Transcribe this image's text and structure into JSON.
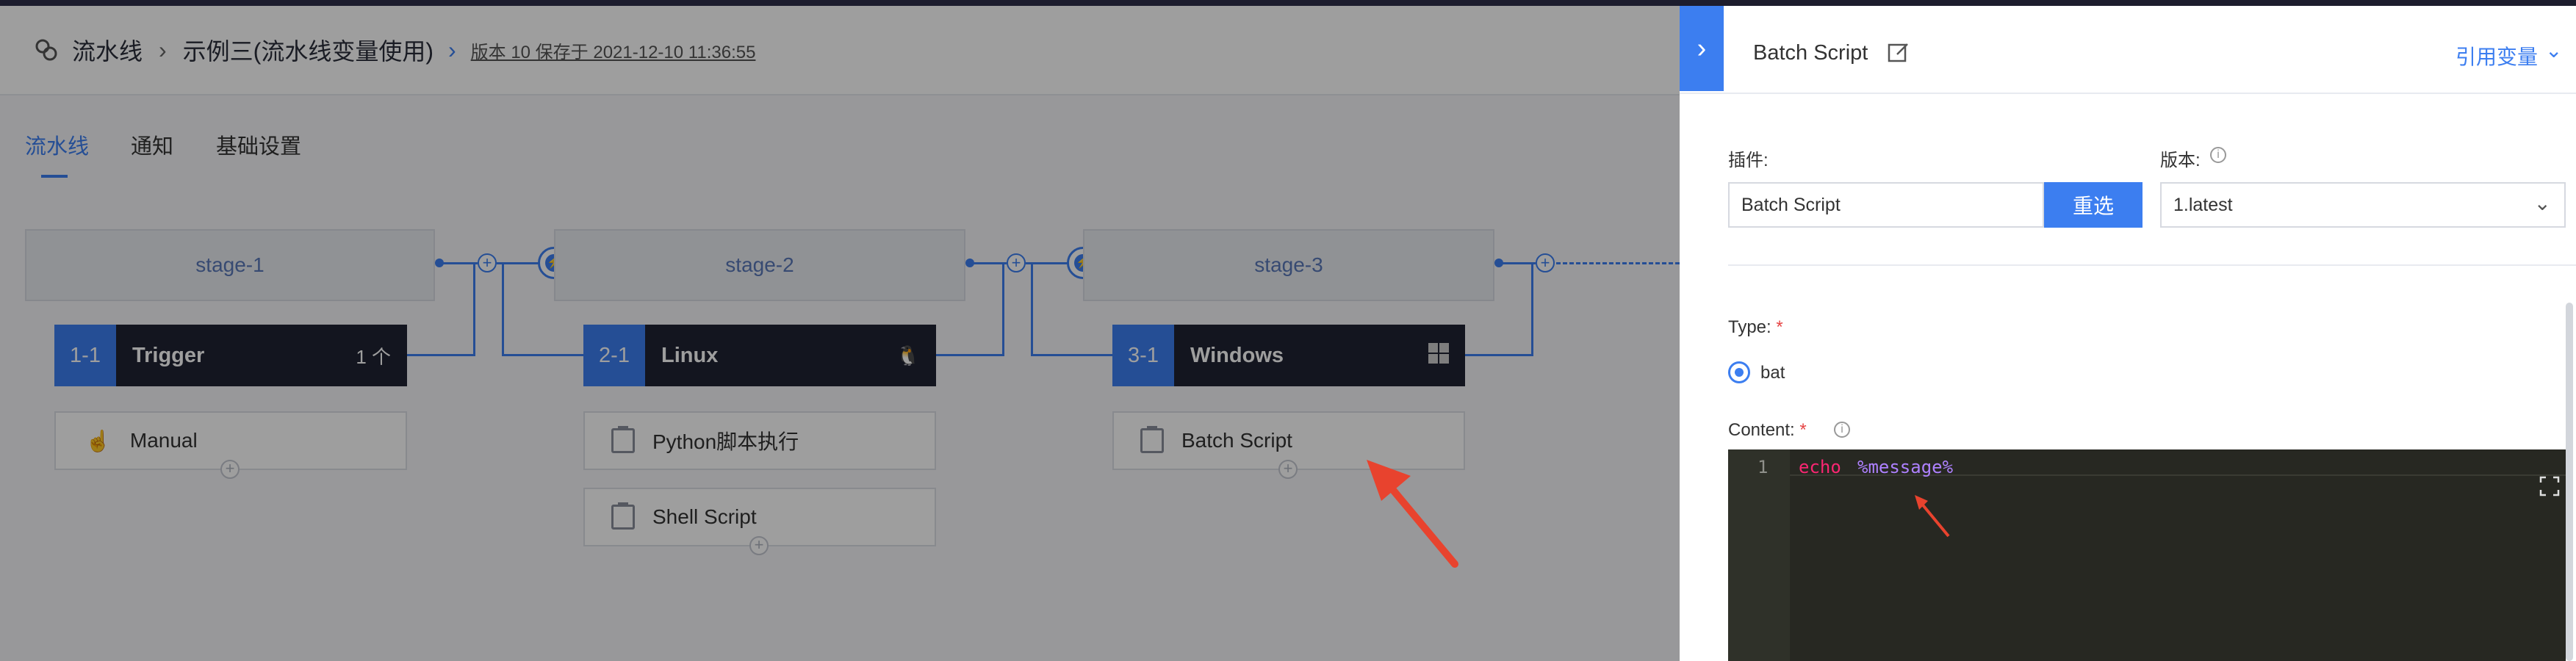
{
  "header": {
    "section": "流水线",
    "pipeline_name": "示例三(流水线变量使用)",
    "version_info": "版本 10 保存于 2021-12-10 11:36:55"
  },
  "tabs": [
    "流水线",
    "通知",
    "基础设置"
  ],
  "stages": [
    {
      "name": "stage-1",
      "job": {
        "index": "1-1",
        "name": "Trigger",
        "extra": "1 个"
      },
      "tasks": [
        "Manual"
      ]
    },
    {
      "name": "stage-2",
      "job": {
        "index": "2-1",
        "name": "Linux",
        "os_icon": "linux-penguin-icon"
      },
      "tasks": [
        "Python脚本执行",
        "Shell Script"
      ]
    },
    {
      "name": "stage-3",
      "job": {
        "index": "3-1",
        "name": "Windows",
        "os_icon": "windows-icon"
      },
      "tasks": [
        "Batch Script"
      ]
    }
  ],
  "panel": {
    "title": "Batch Script",
    "ref_vars": "引用变量",
    "plugin_label": "插件:",
    "plugin_value": "Batch Script",
    "reselect": "重选",
    "version_label": "版本:",
    "version_value": "1.latest",
    "type_label": "Type:",
    "type_option": "bat",
    "content_label": "Content:",
    "code": {
      "line_number": "1",
      "keyword": "echo",
      "variable": "%message%"
    }
  },
  "colors": {
    "accent": "#3c7ef0",
    "arrow": "#e8432e",
    "job_bg": "#1f2233",
    "editor_bg": "#272822"
  }
}
